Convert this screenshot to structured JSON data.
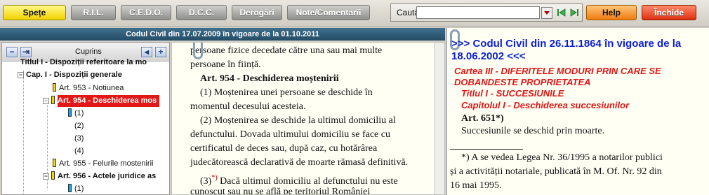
{
  "toolbar": {
    "buttons": [
      "Spețe",
      "R.I.L.",
      "C.E.D.O.",
      "D.C.C.",
      "Derogări",
      "Note/Comentarii"
    ],
    "search_label": "Caută",
    "search_value": "",
    "help_label": "Help",
    "close_label": "Închide"
  },
  "left_panel": {
    "title": "Codul Civil din 17.07.2009 în vigoare de la 01.10.2011",
    "tree": {
      "header": "Cuprins",
      "items": [
        "Titlul I - Dispoziții referitoare la mo",
        "Cap. I - Dispoziții generale",
        "Art. 953 - Notiunea",
        "Art. 954 - Deschiderea mos",
        "(1)",
        "(2)",
        "(3)",
        "(4)",
        "Art. 955 - Felurile mostenirii",
        "Art. 956 - Actele juridice as",
        "(1)"
      ]
    }
  },
  "middle_text": {
    "line_top": "persoane fizice decedate către una sau mai multe",
    "line_top2": "persoane în ființă.",
    "heading": "Art. 954 - Deschiderea moștenirii",
    "p1a": "(1) Moștenirea unei persoane se deschide în",
    "p1b": "momentul decesului acesteia.",
    "p2a": "(2) Moștenirea se deschide la ultimul domiciliu al",
    "p2b": "defunctului. Dovada ultimului domiciliu se face cu",
    "p2c": "certificatul de deces sau, după caz, cu hotărârea",
    "p2d": "judecătorească declarativă de moarte rămasă definitivă.",
    "p3_num": "(3)",
    "p3_mark": "*)",
    "p3a": "Dacă ultimul domiciliu al defunctului nu este",
    "p3b": "cunoscut sau nu se află pe teritoriul României"
  },
  "right_panel": {
    "title": ">>> Codul Civil din 26.11.1864 în vigoare de la 18.06.2002 <<<",
    "cartea": "Cartea III - DIFERITELE MODURI PRIN CARE SE DOBANDESTE PROPRIETATEA",
    "titlul": "Titlul I - SUCCESIUNILE",
    "capitolul": "Capitolul  I - Deschiderea succesiunilor",
    "art": "Art. 651*)",
    "art_text": "Succesiunile se deschid prin moarte.",
    "footnote_a": "*) A se vedea Legea Nr. 36/1995 a notarilor publici",
    "footnote_b": "și a activității notariale, publicată în M. Of. Nr. 92 din",
    "footnote_c": "16 mai 1995."
  },
  "colors": {
    "selected_row": "#e01818",
    "right_title": "#0b1fd6",
    "right_headings": "#e01616",
    "active_button": "#f2d200"
  }
}
